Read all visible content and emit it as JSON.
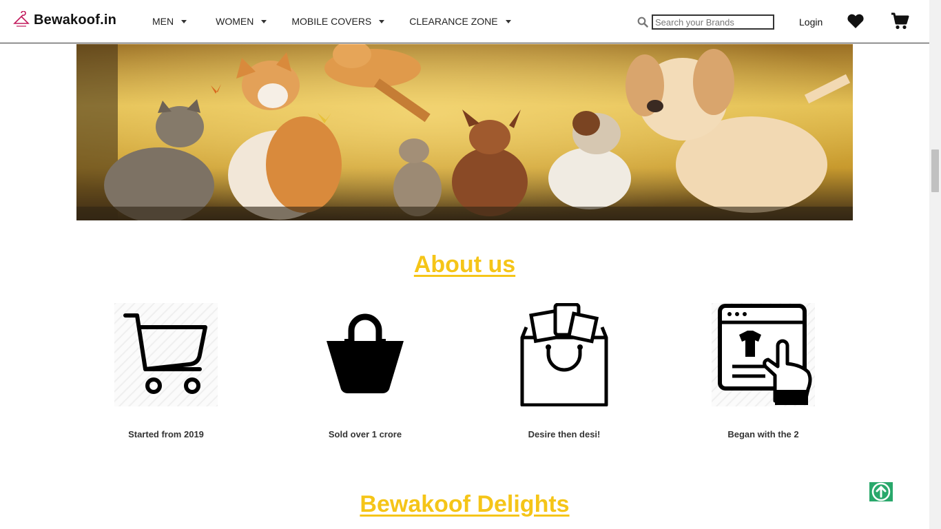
{
  "header": {
    "brand": "Bewakoof.in",
    "nav": [
      {
        "label": "MEN"
      },
      {
        "label": "WOMEN"
      },
      {
        "label": "MOBILE COVERS"
      },
      {
        "label": "CLEARANCE ZONE"
      }
    ],
    "search_placeholder": "Search your Brands",
    "login": "Login"
  },
  "about": {
    "title": "About us",
    "features": [
      {
        "icon": "cart-icon",
        "caption": "Started from 2019"
      },
      {
        "icon": "shopping-bag-icon",
        "caption": "Sold over 1 crore"
      },
      {
        "icon": "shopping-bag-clothes-icon",
        "caption": "Desire then desi!"
      },
      {
        "icon": "online-shopping-icon",
        "caption": "Began with the 2"
      }
    ]
  },
  "delights": {
    "title": "Bewakoof Delights"
  },
  "colors": {
    "accent": "#f5c518",
    "scroll_top": "#29a86b"
  }
}
